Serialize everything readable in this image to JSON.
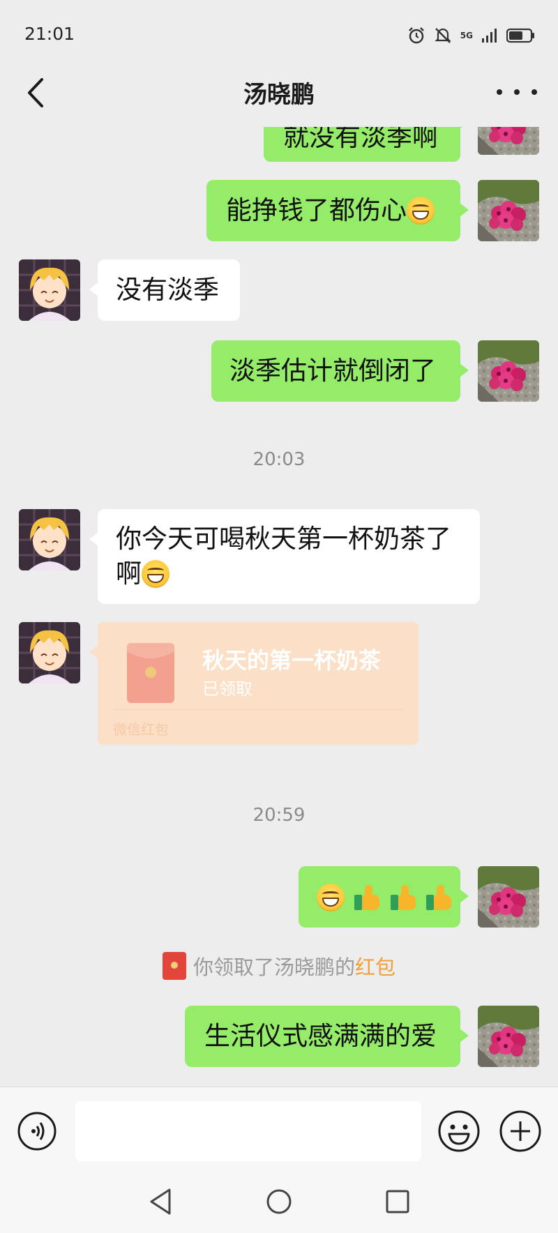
{
  "status": {
    "time": "21:01",
    "network": "5G"
  },
  "header": {
    "title": "汤晓鹏"
  },
  "messages": {
    "m0": "就没有淡季啊",
    "m1": "能挣钱了都伤心",
    "m2": "没有淡季",
    "m3": "淡季估计就倒闭了",
    "t1": "20:03",
    "m4_line1": "你今天可喝秋天第一杯奶茶了",
    "m4_line2": "啊",
    "t2": "20:59",
    "m7": "生活仪式感满满的爱"
  },
  "red_packet": {
    "title": "秋天的第一杯奶茶",
    "status": "已领取",
    "footer": "微信红包"
  },
  "system": {
    "prefix": "你领取了汤晓鹏的",
    "link": "红包"
  },
  "input": {
    "placeholder": ""
  },
  "colors": {
    "mine_bubble": "#95ec69",
    "theirs_bubble": "#ffffff",
    "red_packet_bg": "#fbdfc7",
    "link": "#f0a03a"
  }
}
